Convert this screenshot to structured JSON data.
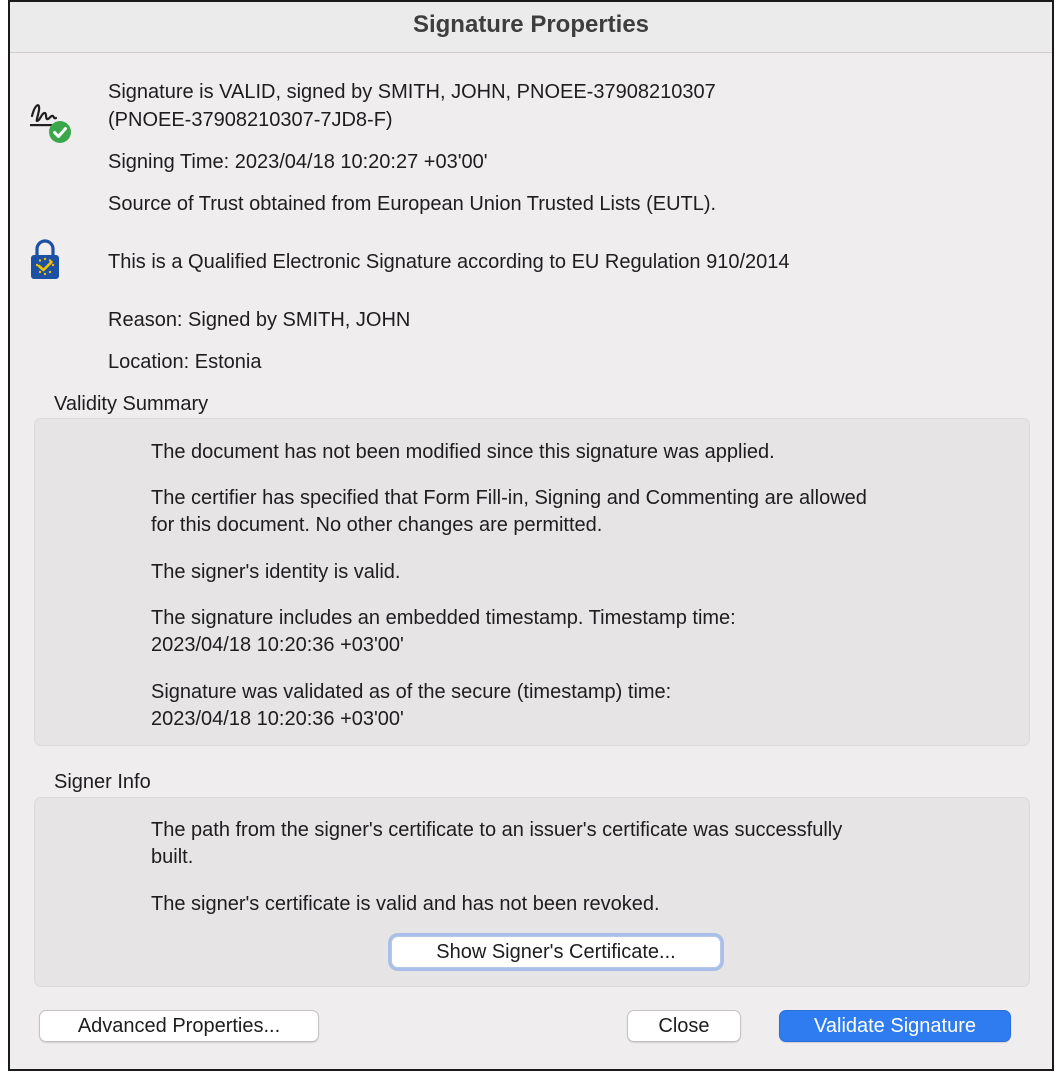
{
  "window": {
    "title": "Signature Properties"
  },
  "header": {
    "status_line1": "Signature is VALID, signed by SMITH, JOHN, PNOEE-37908210307",
    "status_line2": "(PNOEE-37908210307-7JD8-F)",
    "signing_time": "Signing Time:  2023/04/18 10:20:27 +03'00'",
    "source_of_trust": "Source of Trust obtained from European Union Trusted Lists (EUTL).",
    "qualified": "This is a Qualified Electronic Signature according to EU Regulation 910/2014",
    "reason": "Reason:  Signed by SMITH, JOHN",
    "location": "Location:  Estonia"
  },
  "validity_summary": {
    "label": "Validity Summary",
    "items": [
      {
        "line1": "The document has not been modified since this signature was applied.",
        "line2": ""
      },
      {
        "line1": "The certifier has specified that Form Fill-in, Signing and Commenting are allowed",
        "line2": "for this document. No other changes are permitted."
      },
      {
        "line1": "The signer's identity is valid.",
        "line2": ""
      },
      {
        "line1": "The signature includes an embedded timestamp. Timestamp time:",
        "line2": "2023/04/18 10:20:36 +03'00'"
      },
      {
        "line1": "Signature was validated as of the secure (timestamp) time:",
        "line2": "2023/04/18 10:20:36 +03'00'"
      }
    ]
  },
  "signer_info": {
    "label": "Signer Info",
    "items": [
      {
        "line1": "The path from the signer's certificate to an issuer's certificate was successfully",
        "line2": "built."
      },
      {
        "line1": "The signer's certificate is valid and has not been revoked.",
        "line2": ""
      }
    ],
    "show_cert_button": "Show Signer's Certificate..."
  },
  "footer": {
    "advanced_button": "Advanced Properties...",
    "close_button": "Close",
    "validate_button": "Validate Signature"
  },
  "icons": {
    "signature_valid": "signature-check-icon",
    "qualified_lock": "eu-lock-icon"
  },
  "colors": {
    "accent": "#2f7cf0",
    "valid_green": "#3aa84a",
    "eu_blue": "#1d4fa3",
    "eu_gold": "#f2c200"
  }
}
